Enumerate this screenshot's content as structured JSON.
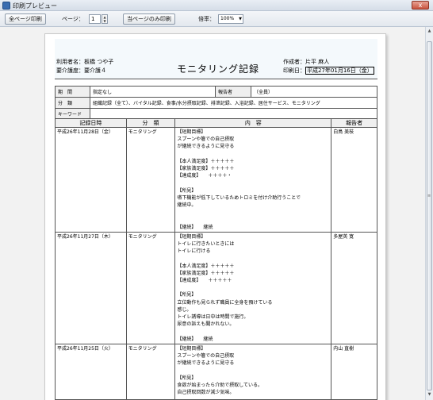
{
  "window": {
    "title": "印刷プレビュー",
    "close": "x"
  },
  "toolbar": {
    "print_all": "全ページ印刷",
    "page_label": "ページ：",
    "page_value": "1",
    "print_current": "当ページのみ印刷",
    "zoom_label": "倍率：",
    "zoom_value": "100%"
  },
  "report": {
    "user_label": "利用者名：",
    "user_name": "板橋 つや子",
    "care_label": "要介護度：",
    "care_level": "要介護４",
    "title": "モニタリング記録",
    "author_label": "作成者：",
    "author_name": "片平 麻人",
    "print_date_label": "印刷日：",
    "print_date": "平成27年01月16日（金）",
    "filter": {
      "period_label": "期　間",
      "period_value": "指定なし",
      "reporter_label": "報告者",
      "reporter_value": "（全員）",
      "category_label": "分　類",
      "category_value": "組織記録（全て）、バイタル記録、食事/水分摂取記録、排泄記録、入浴記録、居住サービス、モニタリング",
      "keyword_label": "キーワード",
      "keyword_value": ""
    },
    "columns": [
      "記録日時",
      "分　類",
      "内　容",
      "報告者"
    ],
    "rows": [
      {
        "date": "平成26年11月28日（金）",
        "category": "モニタリング",
        "content": "【短期目標】\nスプーンや箸での自己摂取\nが継続できるように見守る\n\n【本人満足度】＋＋＋＋＋\n【家族満足度】＋＋＋＋＋\n【達成度】　　＋＋＋＋・\n\n【所見】\n嚥下機能が低下しているためトロミを付け介助行うことで\n継続中。\n\n\n【継続】　　継続",
        "reporter": "白鳥 美枝"
      },
      {
        "date": "平成26年11月27日（木）",
        "category": "モニタリング",
        "content": "【短期目標】\nトイレに行きたいときには\nトイレに行ける\n\n【本人満足度】＋＋＋＋＋\n【家族満足度】＋＋＋＋＋\n【達成度】　　＋＋＋＋＋\n\n【所見】\n立位動作も見られず職員に全身を預けている\n感じ。\nトイレ誘導は日中は時間で施行。\n尿意の訴えも聞かれない。\n\n【継続】　　継続",
        "reporter": "多屋英 寛"
      },
      {
        "date": "平成26年11月25日（火）",
        "category": "モニタリング",
        "content": "【短期目標】\nスプーンや箸での自己摂取\nが継続できるように見守る\n\n【所見】\n食欲が始まったら介助で摂取している。\n自己摂取回数が減少気味。",
        "reporter": "内山 直樹"
      }
    ]
  }
}
